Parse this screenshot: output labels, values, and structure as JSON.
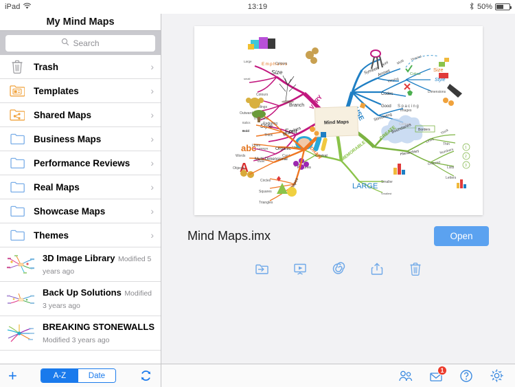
{
  "status_bar": {
    "device": "iPad",
    "wifi_icon": "wifi-icon",
    "time": "13:19",
    "bluetooth_icon": "bluetooth-icon",
    "battery_percent": "50%",
    "battery_icon": "battery-half-icon"
  },
  "sidebar": {
    "title": "My Mind Maps",
    "search": {
      "placeholder": "Search",
      "icon": "search-icon"
    },
    "folders": [
      {
        "label": "Trash",
        "icon": "trash-icon",
        "icon_color": "#9b9b9f",
        "chevron": "›"
      },
      {
        "label": "Templates",
        "icon": "folder-template-icon",
        "icon_color": "#f0a23c",
        "chevron": "›"
      },
      {
        "label": "Shared Maps",
        "icon": "folder-shared-icon",
        "icon_color": "#f0a23c",
        "chevron": "›"
      },
      {
        "label": "Business Maps",
        "icon": "folder-icon",
        "icon_color": "#7aaee8",
        "chevron": "›"
      },
      {
        "label": "Performance Reviews",
        "icon": "folder-icon",
        "icon_color": "#7aaee8",
        "chevron": "›"
      },
      {
        "label": "Real Maps",
        "icon": "folder-icon",
        "icon_color": "#7aaee8",
        "chevron": "›"
      },
      {
        "label": "Showcase Maps",
        "icon": "folder-icon",
        "icon_color": "#7aaee8",
        "chevron": "›"
      },
      {
        "label": "Themes",
        "icon": "folder-icon",
        "icon_color": "#7aaee8",
        "chevron": "›"
      }
    ],
    "files": [
      {
        "name": "3D Image Library",
        "modified": "Modified 5 years ago"
      },
      {
        "name": "Back Up  Solutions",
        "modified": "Modified 3 years ago"
      },
      {
        "name": "BREAKING STONEWALLS",
        "modified": "Modified 3 years ago"
      }
    ],
    "toolbar": {
      "add_icon": "plus-icon",
      "add_label": "+",
      "sort_options": [
        {
          "label": "A-Z",
          "selected": true
        },
        {
          "label": "Date",
          "selected": false
        }
      ],
      "refresh_icon": "refresh-icon"
    }
  },
  "detail": {
    "document_title": "Mind Maps.imx",
    "open_button": "Open",
    "actions": [
      {
        "icon": "move-to-folder-icon",
        "name": "move-to-folder"
      },
      {
        "icon": "presentation-icon",
        "name": "presentation"
      },
      {
        "icon": "spiral-brainstorm-icon",
        "name": "brainstorm"
      },
      {
        "icon": "share-icon",
        "name": "share"
      },
      {
        "icon": "trash-icon",
        "name": "delete"
      }
    ],
    "bottom_toolbar": [
      {
        "icon": "people-icon",
        "name": "contacts",
        "badge": null
      },
      {
        "icon": "inbox-mail-icon",
        "name": "inbox",
        "badge": "1"
      },
      {
        "icon": "help-icon",
        "name": "help",
        "badge": null
      },
      {
        "icon": "gear-icon",
        "name": "settings",
        "badge": null
      }
    ]
  },
  "mindmap": {
    "center": "Mind Maps",
    "branches": [
      {
        "name": "VARY",
        "color": "#c2187f",
        "children": [
          {
            "label": "Emphasis",
            "children": [
              "Colours"
            ]
          },
          {
            "label": "Size",
            "children": [
              "Large",
              "small"
            ]
          },
          {
            "label": "Branch",
            "children": [
              "Colours",
              "Endings",
              "Thickness"
            ]
          },
          {
            "label": "Font",
            "children": [
              "Style",
              "Italics",
              "Bold"
            ]
          },
          {
            "label": "Word",
            "children": [
              "UPPER",
              "lower",
              "Case"
            ]
          }
        ]
      },
      {
        "name": "USE",
        "color": "#1f7fc4",
        "children": [
          {
            "label": "Symbols",
            "children": [
              "Key"
            ]
          },
          {
            "label": "Arrows",
            "children": [
              "Multi",
              "Headed"
            ]
          },
          {
            "label": "Codes",
            "children": [
              "Varying",
              "Colour",
              "Size",
              "Style",
              "Dimensions"
            ]
          },
          {
            "label": "Good Spacing",
            "children": []
          },
          {
            "label": "Stimulating",
            "children": [
              "Images",
              "Colours"
            ]
          }
        ]
      },
      {
        "name": "CREATE",
        "color": "#7cb342",
        "children": [
          {
            "label": "Boundaries",
            "children": [
              "Borders"
            ]
          },
          {
            "label": "Hierarchies",
            "children": [
              "Lines",
              "Thick",
              "Thin"
            ]
          },
          {
            "label": "Ordered",
            "children": [
              "Numbers",
              "Lists",
              "Letters"
            ]
          }
        ]
      },
      {
        "name": "MEMORABLE",
        "color": "#8bc34a",
        "children": [
          {
            "label": "Central",
            "children": [
              "Image"
            ]
          },
          {
            "label": "Pictures",
            "children": []
          },
          {
            "label": "LARGE",
            "children": [
              "Smaller",
              "Smallest"
            ]
          }
        ]
      },
      {
        "name": "DRAW",
        "color": "#ef7722",
        "children": [
          {
            "label": "Branches",
            "children": [
              "Radiating",
              "Thick",
              "Outwards"
            ]
          },
          {
            "label": "Organic",
            "children": [
              "Lines"
            ]
          },
          {
            "label": "Multi-Dimensional",
            "children": [
              "Words",
              "Objects"
            ]
          },
          {
            "label": "Shapes",
            "children": [
              "Circles",
              "Squares",
              "Triangles"
            ]
          }
        ]
      }
    ]
  }
}
